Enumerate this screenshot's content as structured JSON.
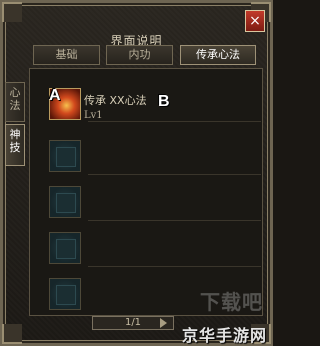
{
  "window": {
    "title": "界面说明",
    "close_glyph": "×"
  },
  "tabs": [
    {
      "label": "基础",
      "active": false
    },
    {
      "label": "内功",
      "active": false
    },
    {
      "label": "传承心法",
      "active": true
    }
  ],
  "side_tabs": [
    {
      "label": "心法",
      "active": false
    },
    {
      "label": "神技",
      "active": true
    }
  ],
  "skills": [
    {
      "name": "传承 XX心法",
      "level": "Lv1",
      "marker_a": "A",
      "marker_b": "B"
    }
  ],
  "pager": {
    "text": "1/1"
  },
  "watermark": {
    "top": "下载吧",
    "bottom": "京华手游网"
  }
}
